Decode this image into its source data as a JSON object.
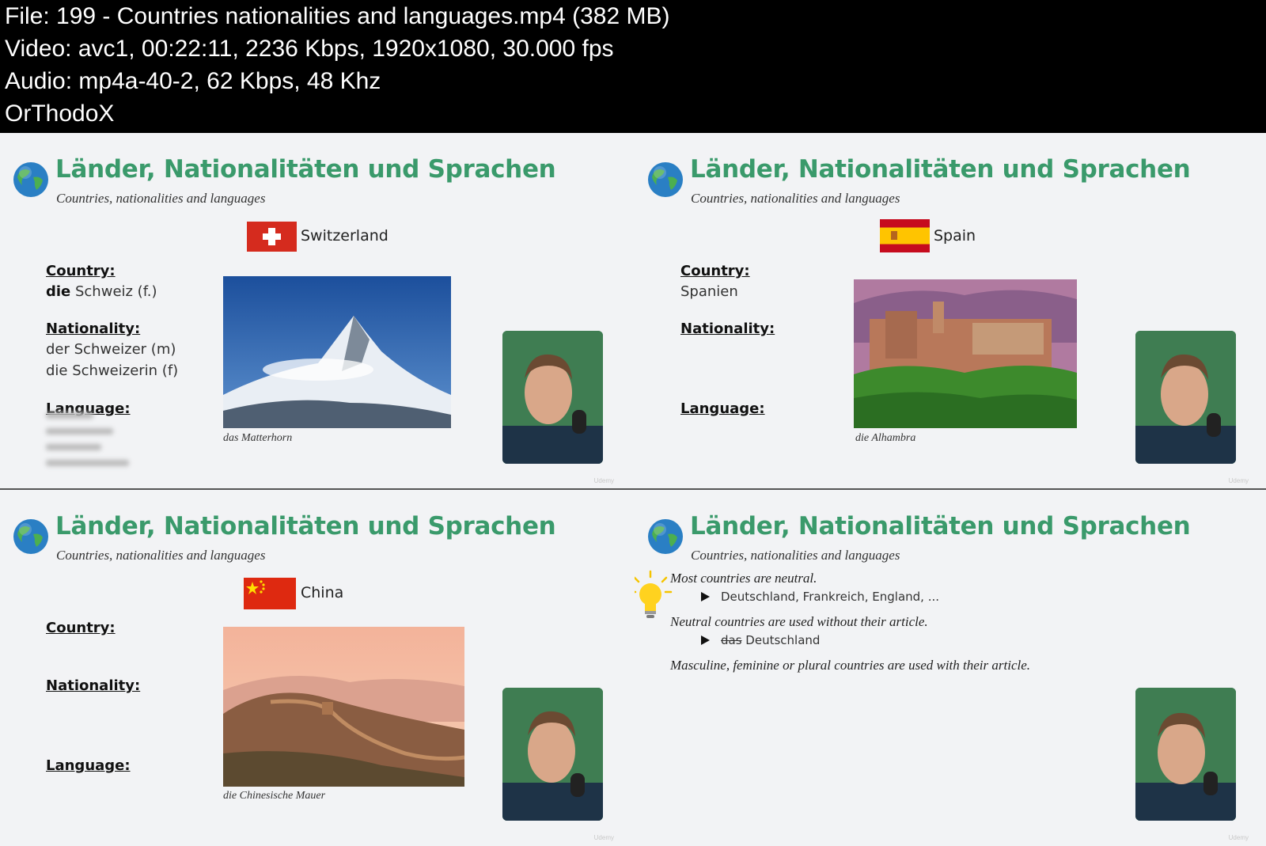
{
  "file_info": {
    "file": "File: 199 - Countries nationalities and languages.mp4 (382 MB)",
    "video": "Video: avc1, 00:22:11, 2236 Kbps, 1920x1080, 30.000 fps",
    "audio": "Audio: mp4a-40-2, 62 Kbps, 48 Khz",
    "tag": "OrThodoX"
  },
  "slide_title": "Länder, Nationalitäten und Sprachen",
  "slide_subtitle": "Countries, nationalities and languages",
  "labels": {
    "country": "Country:",
    "nationality": "Nationality:",
    "language": "Language:"
  },
  "panel_switzerland": {
    "country_name": "Switzerland",
    "article": "die",
    "country_word": " Schweiz (f.)",
    "nationality_m": "der Schweizer (m)",
    "nationality_f": "die Schweizerin (f)",
    "caption": "das Matterhorn"
  },
  "panel_spain": {
    "country_name": "Spain",
    "country_word": "Spanien",
    "caption": "die Alhambra"
  },
  "panel_china": {
    "country_name": "China",
    "caption": "die Chinesische Mauer"
  },
  "panel_notes": {
    "note1": "Most countries are neutral.",
    "bullet1": "Deutschland, Frankreich, England, ...",
    "note2": "Neutral countries are used without their article.",
    "bullet2_struck": "das",
    "bullet2_rest": " Deutschland",
    "note3": "Masculine, feminine or plural countries are used with their article."
  },
  "watermark": "Udemy",
  "colors": {
    "title_green": "#3a9a6b",
    "background": "#f2f3f5",
    "info_bar": "#000000"
  },
  "icons": [
    "globe-icon",
    "lightbulb-icon",
    "swiss-flag",
    "spanish-flag",
    "chinese-flag"
  ]
}
